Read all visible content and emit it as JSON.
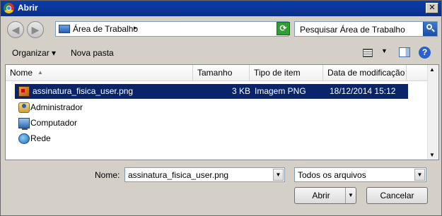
{
  "window": {
    "title": "Abrir",
    "close_glyph": "✕"
  },
  "nav": {
    "back_glyph": "◀",
    "forward_glyph": "▶",
    "address_text": "Área de Trabalho",
    "address_sep": "▸",
    "address_drop": "▼",
    "refresh_glyph": "⟳",
    "search_placeholder": "Pesquisar Área de Trabalho"
  },
  "toolbar": {
    "organize": "Organizar ▾",
    "new_folder": "Nova pasta",
    "views_drop": "▼",
    "help": "?"
  },
  "columns": [
    {
      "label": "Nome",
      "sort": "▲"
    },
    {
      "label": "Tamanho"
    },
    {
      "label": "Tipo de item"
    },
    {
      "label": "Data de modificação"
    }
  ],
  "files": [
    {
      "name": "assinatura_fisica_user.png",
      "size": "3 KB",
      "type": "Imagem PNG",
      "modified": "18/12/2014 15:12",
      "selected": true,
      "icon": "png-file-icon"
    },
    {
      "name": "Administrador",
      "icon": "user-folder-icon"
    },
    {
      "name": "Computador",
      "icon": "computer-icon"
    },
    {
      "name": "Rede",
      "icon": "network-icon"
    }
  ],
  "scroll": {
    "up": "▲",
    "down": "▼"
  },
  "footer": {
    "name_label": "Nome:",
    "filename_value": "assinatura_fisica_user.png",
    "filetype_value": "Todos os arquivos",
    "combo_drop": "▼",
    "open_button": "Abrir",
    "open_split": "▼",
    "cancel_button": "Cancelar"
  },
  "colors": {
    "selection": "#0a246a",
    "titlebar": "#0c3daa",
    "dialog_bg": "#d4d0c8"
  }
}
